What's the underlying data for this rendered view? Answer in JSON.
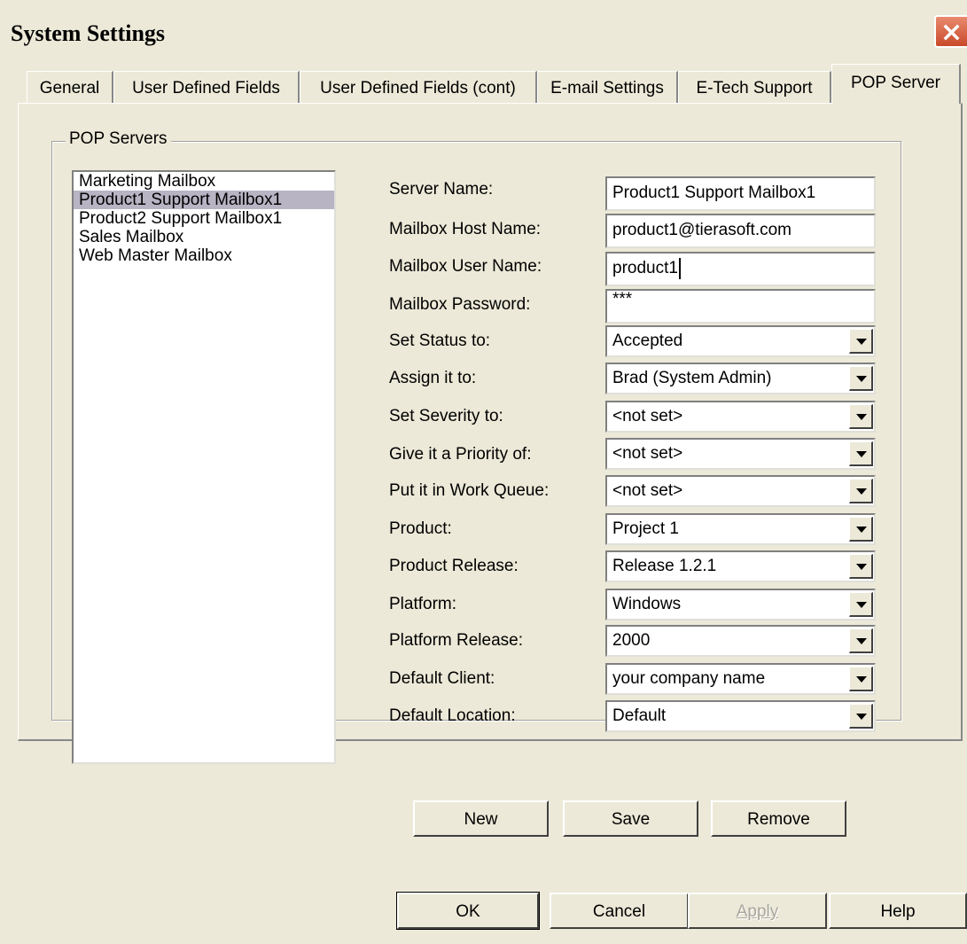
{
  "window": {
    "title": "System Settings"
  },
  "tabs": [
    {
      "label": "General"
    },
    {
      "label": "User Defined Fields"
    },
    {
      "label": "User Defined Fields (cont)"
    },
    {
      "label": "E-mail Settings"
    },
    {
      "label": "E-Tech Support"
    },
    {
      "label": "POP Server",
      "active": true
    }
  ],
  "pop": {
    "group_label": "POP Servers",
    "servers": [
      "Marketing Mailbox",
      "Product1 Support Mailbox1",
      "Product2 Support Mailbox1",
      "Sales Mailbox",
      "Web Master Mailbox"
    ],
    "selected_server": "Product1 Support Mailbox1",
    "fields": {
      "server_name": {
        "label": "Server Name:",
        "value": "Product1 Support Mailbox1"
      },
      "host_name": {
        "label": "Mailbox Host Name:",
        "value": "product1@tierasoft.com"
      },
      "user_name": {
        "label": "Mailbox User Name:",
        "value": "product1"
      },
      "password": {
        "label": "Mailbox Password:",
        "value": "***"
      },
      "status": {
        "label": "Set Status to:",
        "value": "Accepted"
      },
      "assign": {
        "label": "Assign it to:",
        "value": "Brad (System Admin)"
      },
      "severity": {
        "label": "Set Severity to:",
        "value": "<not set>"
      },
      "priority": {
        "label": "Give it a Priority of:",
        "value": "<not set>"
      },
      "work_queue": {
        "label": "Put it in Work Queue:",
        "value": "<not set>"
      },
      "product": {
        "label": "Product:",
        "value": "Project 1"
      },
      "product_release": {
        "label": "Product Release:",
        "value": "Release 1.2.1"
      },
      "platform": {
        "label": "Platform:",
        "value": "Windows"
      },
      "platform_release": {
        "label": "Platform Release:",
        "value": "2000"
      },
      "default_client": {
        "label": "Default Client:",
        "value": "your company name"
      },
      "default_location": {
        "label": "Default Location:",
        "value": "Default"
      }
    },
    "buttons": {
      "new": "New",
      "save": "Save",
      "remove": "Remove"
    }
  },
  "dialog_buttons": {
    "ok": "OK",
    "cancel": "Cancel",
    "apply": "Apply",
    "help": "Help"
  }
}
